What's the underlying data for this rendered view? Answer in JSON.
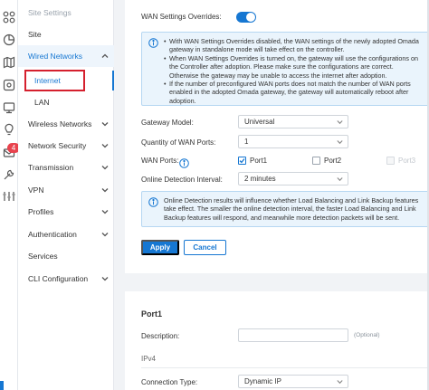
{
  "colors": {
    "accent": "#1677d2",
    "badge": "#e8424d",
    "highlight": "#d5202e",
    "info_bg": "#eaf4fc"
  },
  "rail": {
    "icons": [
      "grid-icon",
      "pie-chart-icon",
      "map-icon",
      "device-icon",
      "insight-icon",
      "bulb-icon",
      "alert-icon",
      "tools-icon",
      "settings-icon"
    ],
    "badge": "4"
  },
  "sidebar": {
    "title": "Site Settings",
    "items": [
      {
        "label": "Site"
      },
      {
        "label": "Wired Networks"
      },
      {
        "label": "Wireless Networks"
      },
      {
        "label": "Network Security"
      },
      {
        "label": "Transmission"
      },
      {
        "label": "VPN"
      },
      {
        "label": "Profiles"
      },
      {
        "label": "Authentication"
      },
      {
        "label": "Services"
      },
      {
        "label": "CLI Configuration"
      }
    ],
    "sub_items": [
      {
        "label": "Internet"
      },
      {
        "label": "LAN"
      }
    ]
  },
  "wan": {
    "override_label": "WAN Settings Overrides:",
    "override_on": true,
    "info_lines": [
      "With WAN Settings Overrides disabled, the WAN settings of the newly adopted Omada gateway in standalone mode will take effect on the controller.",
      "When WAN Settings Overrides is turned on, the gateway will use the configurations on the Controller after adoption. Please make sure the configurations are correct. Otherwise the gateway may be unable to access the internet after adoption.",
      "If the number of preconfigured WAN ports does not match the number of WAN ports enabled in the adopted Omada gateway, the gateway will automatically reboot after adoption."
    ],
    "gateway_model_label": "Gateway Model:",
    "gateway_model_value": "Universal",
    "wan_qty_label": "Quantity of WAN Ports:",
    "wan_qty_value": "1",
    "wan_ports_label": "WAN Ports:",
    "ports": [
      {
        "label": "Port1",
        "checked": true,
        "disabled": false
      },
      {
        "label": "Port2",
        "checked": false,
        "disabled": false
      },
      {
        "label": "Port3",
        "checked": false,
        "disabled": true
      }
    ],
    "detect_label": "Online Detection Interval:",
    "detect_value": "2 minutes",
    "detect_info": "Online Detection results will influence whether Load Balancing and Link Backup features take effect. The smaller the online detection interval, the faster Load Balancing and Link Backup features will respond, and meanwhile more detection packets will be sent.",
    "apply_label": "Apply",
    "cancel_label": "Cancel"
  },
  "port1": {
    "title": "Port1",
    "description_label": "Description:",
    "description_value": "",
    "description_hint": "(Optional)",
    "ipv4_label": "IPv4",
    "conn_type_label": "Connection Type:",
    "conn_type_value": "Dynamic IP"
  }
}
